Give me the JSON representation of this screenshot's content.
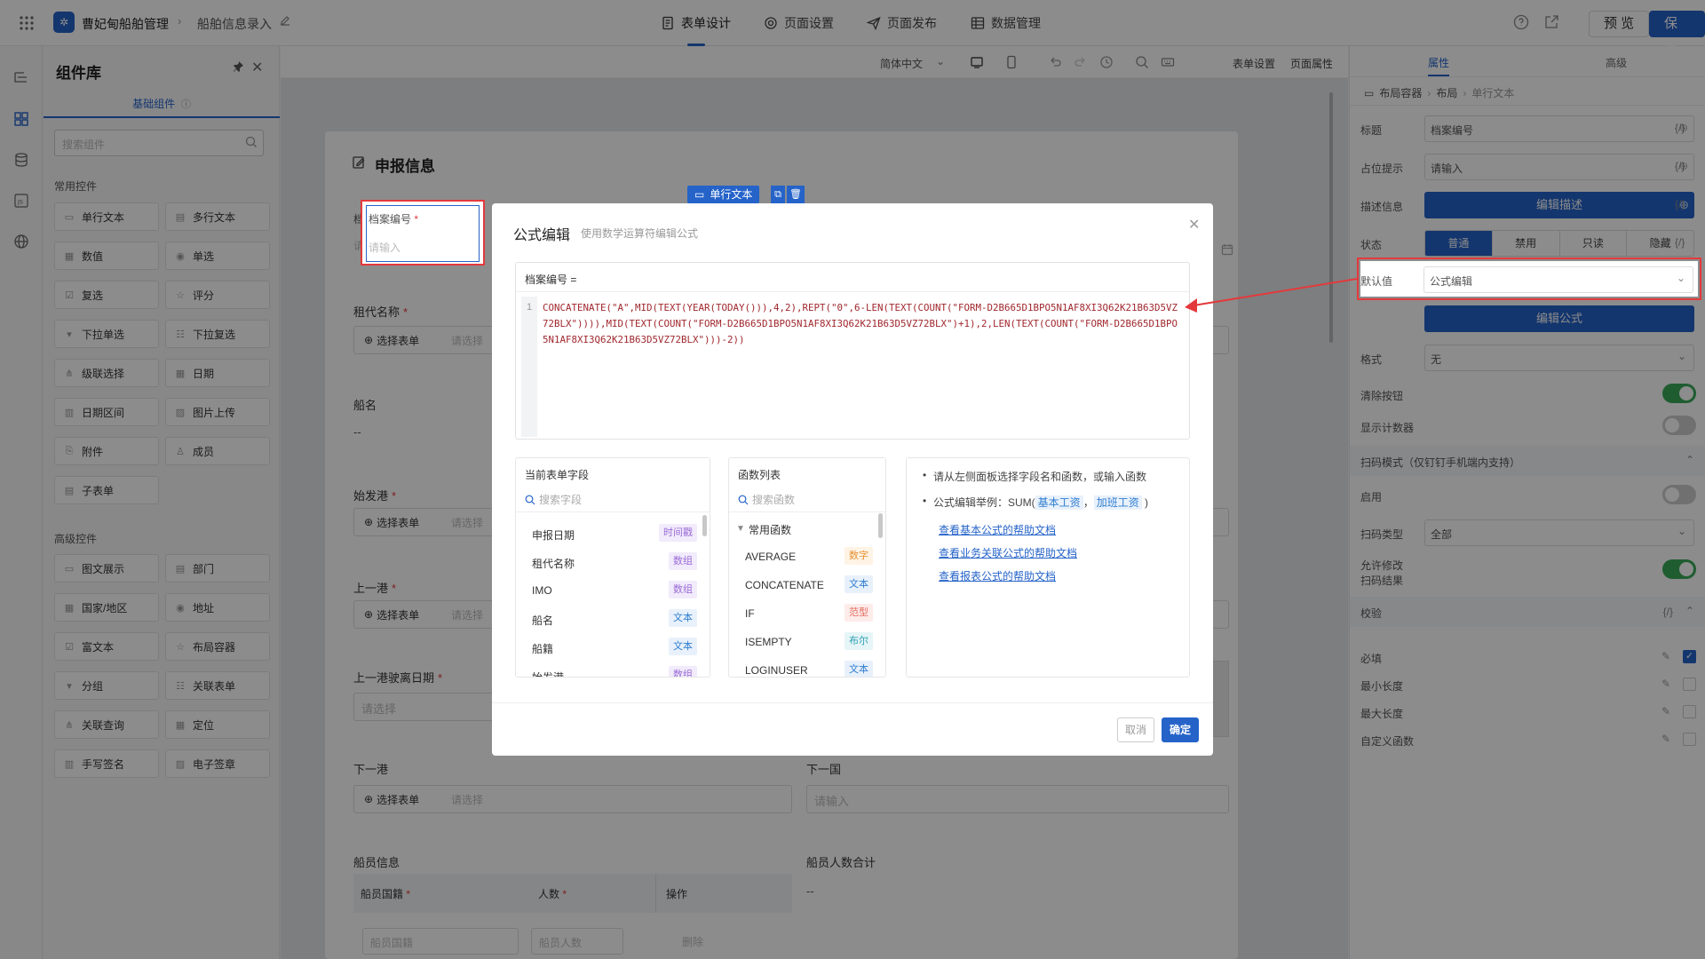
{
  "topbar": {
    "app_name": "曹妃甸船舶管理",
    "page_name": "船舶信息录入",
    "tabs": [
      "表单设计",
      "页面设置",
      "页面发布",
      "数据管理"
    ],
    "preview": "预 览",
    "save": "保 存"
  },
  "library": {
    "title": "组件库",
    "tab": "基础组件",
    "search_placeholder": "搜索组件",
    "common_title": "常用控件",
    "common": [
      "单行文本",
      "多行文本",
      "数值",
      "单选",
      "复选",
      "评分",
      "下拉单选",
      "下拉复选",
      "级联选择",
      "日期",
      "日期区间",
      "图片上传",
      "附件",
      "成员",
      "子表单"
    ],
    "advanced_title": "高级控件",
    "advanced": [
      "图文展示",
      "部门",
      "国家/地区",
      "地址",
      "富文本",
      "布局容器",
      "分组",
      "关联表单",
      "关联查询",
      "定位",
      "手写签名",
      "电子签章"
    ]
  },
  "toolbar": {
    "lang": "简体中文",
    "form_settings": "表单设置",
    "page_props": "页面属性"
  },
  "form": {
    "section_title": "申报信息",
    "field_file_no": "档案编号",
    "field_file_no_ph": "请输入",
    "floating_tag": "单行文本",
    "field_charter": "租代名称",
    "select_form": "选择表单",
    "select_ph": "请选择",
    "field_ship": "船名",
    "dash": "--",
    "field_origin": "始发港",
    "field_prev_port": "上一港",
    "field_prev_date": "上一港驶离日期",
    "field_next_port": "下一港",
    "field_next_country": "下一国",
    "input_ph": "请输入",
    "crew_info": "船员信息",
    "crew_total": "船员人数合计",
    "crew_cols": [
      "船员国籍",
      "人数",
      "操作"
    ],
    "crew_row": [
      "船员国籍",
      "船员人数",
      "删除"
    ]
  },
  "right_panel": {
    "tabs": [
      "属性",
      "高级"
    ],
    "breadcrumb": [
      "布局容器",
      "布局",
      "单行文本"
    ],
    "title_label": "标题",
    "title_value": "档案编号",
    "placeholder_label": "占位提示",
    "placeholder_value": "请输入",
    "desc_label": "描述信息",
    "desc_btn": "编辑描述",
    "state_label": "状态",
    "states": [
      "普通",
      "禁用",
      "只读",
      "隐藏"
    ],
    "default_label": "默认值",
    "default_value": "公式编辑",
    "edit_formula_btn": "编辑公式",
    "format_label": "格式",
    "format_value": "无",
    "clear_btn_label": "清除按钮",
    "counter_label": "显示计数器",
    "scan_section": "扫码模式（仅钉钉手机端内支持）",
    "enable_label": "启用",
    "scan_type_label": "扫码类型",
    "scan_type_value": "全部",
    "allow_modify_label_1": "允许修改",
    "allow_modify_label_2": "扫码结果",
    "validate_section": "校验",
    "validate_items": [
      "必填",
      "最小长度",
      "最大长度",
      "自定义函数"
    ],
    "fx": "{/}"
  },
  "modal": {
    "title": "公式编辑",
    "subtitle": "使用数学运算符编辑公式",
    "editor_label": "档案编号 =",
    "line_no": "1",
    "formula": "CONCATENATE(\"A\",MID(TEXT(YEAR(TODAY())),4,2),REPT(\"0\",6-LEN(TEXT(COUNT(\"FORM-D2B665D1BPO5N1AF8XI3Q62K21B63D5VZ72BLX\")))),MID(TEXT(COUNT(\"FORM-D2B665D1BPO5N1AF8XI3Q62K21B63D5VZ72BLX\")+1),2,LEN(TEXT(COUNT(\"FORM-D2B665D1BPO5N1AF8XI3Q62K21B63D5VZ72BLX\")))-2))",
    "fields_title": "当前表单字段",
    "fields_search": "搜索字段",
    "fields": [
      {
        "name": "申报日期",
        "type": "时间戳"
      },
      {
        "name": "租代名称",
        "type": "数组"
      },
      {
        "name": "IMO",
        "type": "数组"
      },
      {
        "name": "船名",
        "type": "文本"
      },
      {
        "name": "船籍",
        "type": "文本"
      },
      {
        "name": "始发港",
        "type": "数组"
      }
    ],
    "funcs_title": "函数列表",
    "funcs_search": "搜索函数",
    "funcs_group": "常用函数",
    "funcs": [
      {
        "name": "AVERAGE",
        "type": "数字"
      },
      {
        "name": "CONCATENATE",
        "type": "文本"
      },
      {
        "name": "IF",
        "type": "范型"
      },
      {
        "name": "ISEMPTY",
        "type": "布尔"
      },
      {
        "name": "LOGINUSER",
        "type": "文本"
      }
    ],
    "help_1": "请从左侧面板选择字段名和函数，或输入函数",
    "help_2_prefix": "公式编辑举例：SUM(",
    "help_2_a": "基本工资",
    "help_2_sep": "，",
    "help_2_b": "加班工资",
    "help_2_suffix": " )",
    "link_1": "查看基本公式的帮助文档",
    "link_2": "查看业务关联公式的帮助文档",
    "link_3": "查看报表公式的帮助文档",
    "cancel": "取消",
    "ok": "确定"
  },
  "colors": {
    "primary": "#2563c9",
    "toggle_on": "#3aa95a",
    "annotation_red": "#e4393c"
  }
}
